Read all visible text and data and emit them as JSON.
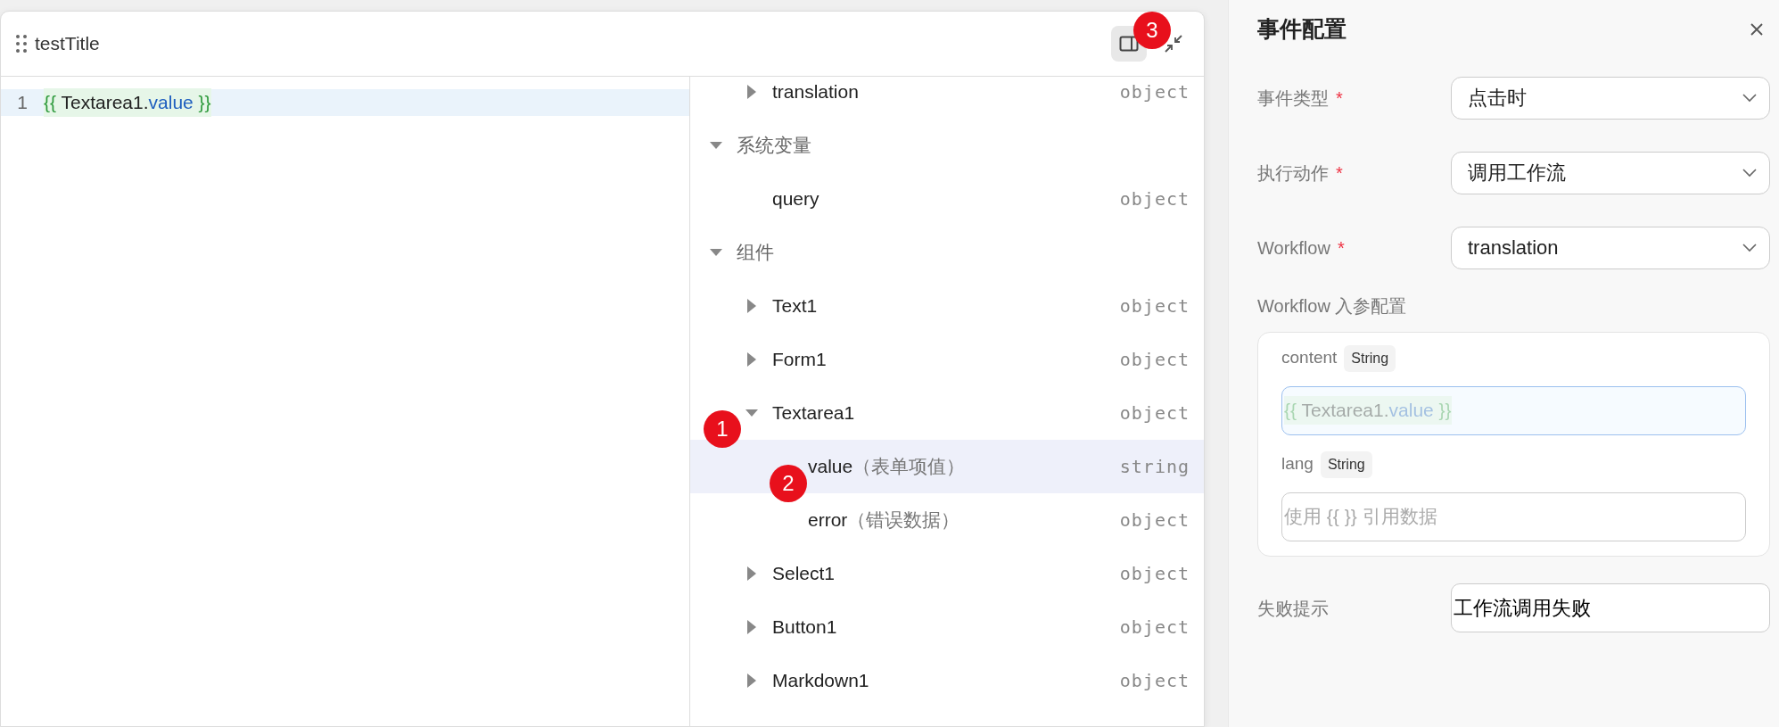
{
  "popup": {
    "title": "testTitle",
    "editor": {
      "lines": [
        {
          "number": "1",
          "active": true,
          "tokens": [
            {
              "kind": "brace",
              "text": "{{ "
            },
            {
              "kind": "ident",
              "text": "Textarea1"
            },
            {
              "kind": "dot",
              "text": "."
            },
            {
              "kind": "prop",
              "text": "value"
            },
            {
              "kind": "brace",
              "text": " }}"
            }
          ]
        }
      ]
    },
    "tree": [
      {
        "kind": "item",
        "label": "translation",
        "type": "object",
        "expanded": false,
        "selected": false
      },
      {
        "kind": "group",
        "label": "系统变量",
        "expanded": true,
        "children": [
          {
            "kind": "item",
            "label": "query",
            "type": "object",
            "selected": false
          }
        ]
      },
      {
        "kind": "group",
        "label": "组件",
        "expanded": true,
        "children": [
          {
            "kind": "item",
            "label": "Text1",
            "type": "object",
            "expanded": false,
            "selected": false
          },
          {
            "kind": "item",
            "label": "Form1",
            "type": "object",
            "expanded": false,
            "selected": false
          },
          {
            "kind": "item",
            "label": "Textarea1",
            "type": "object",
            "expanded": true,
            "selected": false,
            "children": [
              {
                "kind": "item",
                "label": "value",
                "note": "（表单项值）",
                "type": "string",
                "selected": true
              },
              {
                "kind": "item",
                "label": "error",
                "note": "（错误数据）",
                "type": "object",
                "selected": false
              }
            ]
          },
          {
            "kind": "item",
            "label": "Select1",
            "type": "object",
            "expanded": false,
            "selected": false
          },
          {
            "kind": "item",
            "label": "Button1",
            "type": "object",
            "expanded": false,
            "selected": false
          },
          {
            "kind": "item",
            "label": "Markdown1",
            "type": "object",
            "expanded": false,
            "selected": false
          }
        ]
      }
    ]
  },
  "markers": [
    {
      "label": "1"
    },
    {
      "label": "2"
    },
    {
      "label": "3"
    }
  ],
  "panel": {
    "title": "事件配置",
    "fields": [
      {
        "kind": "select",
        "label": "事件类型",
        "required_mark": "*",
        "value": "点击时"
      },
      {
        "kind": "select",
        "label": "执行动作",
        "required_mark": "*",
        "value": "调用工作流"
      },
      {
        "kind": "select",
        "label": "Workflow",
        "required_mark": "*",
        "value": "translation"
      }
    ],
    "params_title": "Workflow 入参配置",
    "params": [
      {
        "name": "content",
        "type": "String",
        "focused": true,
        "tokens": [
          {
            "kind": "brace",
            "text": "{{ "
          },
          {
            "kind": "ident",
            "text": "Textarea1"
          },
          {
            "kind": "dot",
            "text": "."
          },
          {
            "kind": "prop",
            "text": "value"
          },
          {
            "kind": "brace",
            "text": " }}"
          }
        ]
      },
      {
        "name": "lang",
        "type": "String",
        "focused": false,
        "placeholder": "使用 {{ }} 引用数据"
      }
    ],
    "footer_fields": [
      {
        "kind": "input",
        "label": "失败提示",
        "value": "工作流调用失败"
      }
    ]
  }
}
